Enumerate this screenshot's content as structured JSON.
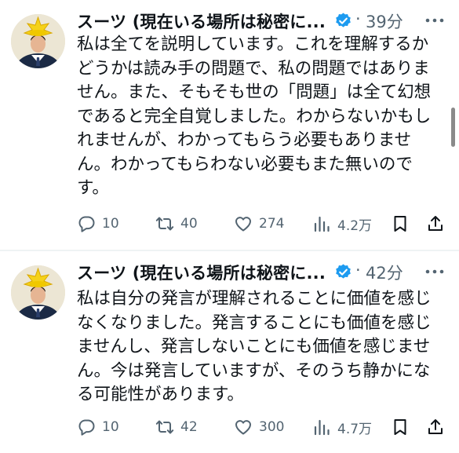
{
  "tweets": [
    {
      "author": "スーツ (現在いる場所は秘密に...",
      "separator": "·",
      "time": "39分",
      "lines": [
        "私は全てを説明しています。これを理解するか",
        "どうかは読み手の問題で、私の問題ではありま",
        "せん。また、そもそも世の「問題」は全て幻想",
        "であると完全自覚しました。わからないかもし",
        "れませんが、わかってもらう必要もありませ",
        "ん。わかってもらわない必要もまた無いので",
        "す。"
      ],
      "replies": "10",
      "retweets": "40",
      "likes": "274",
      "views": "4.2万"
    },
    {
      "author": "スーツ (現在いる場所は秘密に...",
      "separator": "·",
      "time": "42分",
      "lines": [
        "私は自分の発言が理解されることに価値を感じ",
        "なくなりました。発言することにも価値を感じ",
        "ませんし、発言しないことにも価値を感じませ",
        "ん。今は発言していますが、そのうち静かにな",
        "る可能性があります。"
      ],
      "replies": "10",
      "retweets": "42",
      "likes": "300",
      "views": "4.7万"
    }
  ],
  "icons": {
    "reply": "reply-icon",
    "retweet": "retweet-icon",
    "like": "heart-icon",
    "views": "views-icon",
    "bookmark": "bookmark-icon",
    "share": "share-icon",
    "more": "more-icon",
    "verified": "verified-badge-icon"
  },
  "colors": {
    "text": "#0f1419",
    "muted": "#536471",
    "verified": "#1d9bf0",
    "divider": "#eff3f4"
  }
}
